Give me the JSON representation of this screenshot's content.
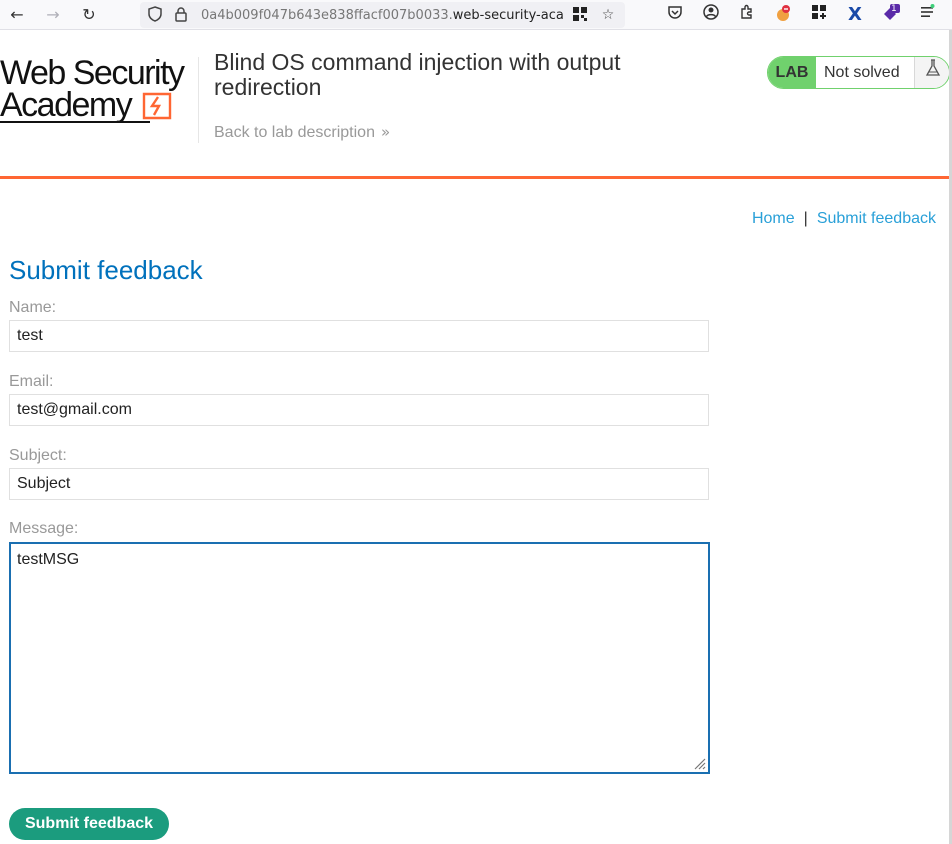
{
  "browser": {
    "url_prefix": "0a4b009f047b643e838ffacf007b0033.",
    "url_host": "web-security-academ",
    "icons": [
      "back-arrow-icon",
      "forward-arrow-icon",
      "reload-icon",
      "shield-icon",
      "lock-icon",
      "qr-code-icon",
      "bookmark-star-icon",
      "pocket-icon",
      "account-icon",
      "extensions-icon",
      "extension-blocker-icon",
      "extension-grid-icon",
      "extension-x-icon",
      "extension-badge-icon",
      "menu-icon"
    ],
    "extension_badge_count": "1"
  },
  "header": {
    "logo_line1": "Web Security",
    "logo_line2": "Academy",
    "lab_title": "Blind OS command injection with output redirection",
    "back_link": "Back to lab description",
    "lab_badge": "LAB",
    "lab_state": "Not solved",
    "accent_color": "#ff6633",
    "status_color": "#70d16d"
  },
  "nav": {
    "home": "Home",
    "separator": "|",
    "submit_feedback": "Submit feedback"
  },
  "form": {
    "heading": "Submit feedback",
    "name_label": "Name:",
    "name_value": "test",
    "email_label": "Email:",
    "email_value": "test@gmail.com",
    "subject_label": "Subject:",
    "subject_value": "Subject",
    "message_label": "Message:",
    "message_value": "testMSG",
    "submit_label": "Submit feedback",
    "heading_color": "#0071bc",
    "button_color": "#1b9c7e"
  }
}
